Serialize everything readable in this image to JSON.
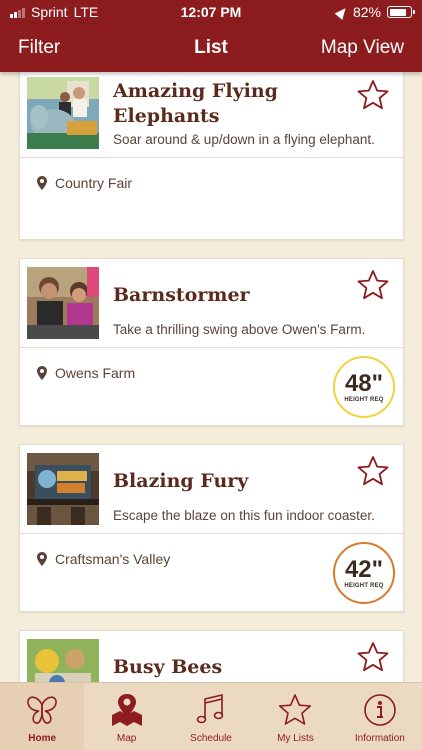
{
  "status_bar": {
    "carrier": "Sprint",
    "network": "LTE",
    "time": "12:07 PM",
    "battery": "82%",
    "battery_level": 0.82
  },
  "nav": {
    "left": "Filter",
    "title": "List",
    "right": "Map View"
  },
  "rides": [
    {
      "name": "Amazing Flying Elephants",
      "description": "Soar around & up/down in a flying elephant.",
      "location": "Country Fair",
      "height_req": null,
      "favorite": false
    },
    {
      "name": "Barnstormer",
      "description": "Take a thrilling swing above Owen's Farm.",
      "location": "Owens Farm",
      "height_req": "48\"",
      "height_label": "HEIGHT REQ",
      "badge_color": "#f2d23c",
      "favorite": false
    },
    {
      "name": "Blazing Fury",
      "description": "Escape the blaze on this fun indoor coaster.",
      "location": "Craftsman's Valley",
      "height_req": "42\"",
      "height_label": "HEIGHT REQ",
      "badge_color": "#d97a2b",
      "favorite": false
    },
    {
      "name": "Busy Bees",
      "favorite": false
    }
  ],
  "tabs": [
    {
      "label": "Home",
      "icon": "butterfly-icon",
      "active": true
    },
    {
      "label": "Map",
      "icon": "map-pin-icon",
      "active": false
    },
    {
      "label": "Schedule",
      "icon": "music-note-icon",
      "active": false
    },
    {
      "label": "My Lists",
      "icon": "star-icon",
      "active": false
    },
    {
      "label": "Information",
      "icon": "info-icon",
      "active": false
    }
  ],
  "colors": {
    "brand": "#8c1c1d",
    "title_text": "#5a2a1c",
    "background": "#f4eddc"
  }
}
